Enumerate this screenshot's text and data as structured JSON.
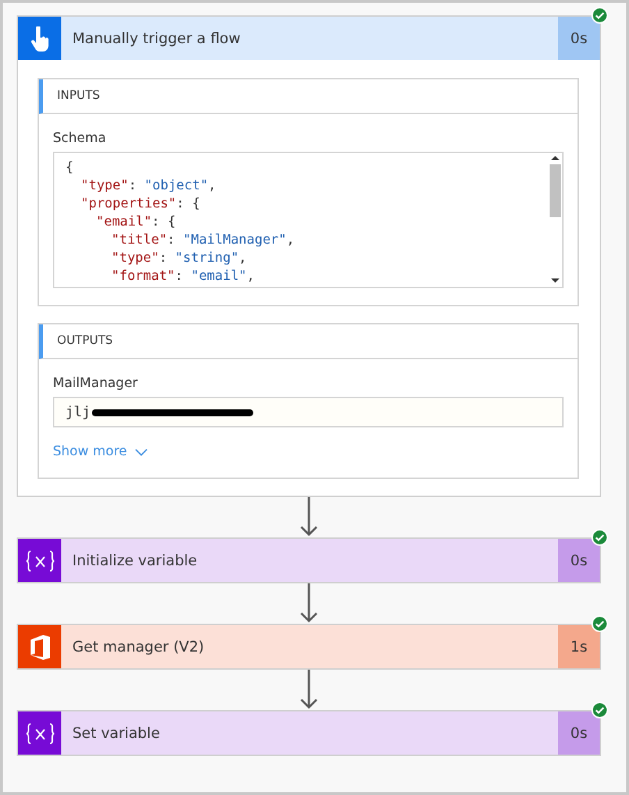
{
  "steps": [
    {
      "kind": "trigger",
      "title": "Manually trigger a flow",
      "duration": "0s",
      "succeeded": true,
      "expanded": true,
      "inputs": {
        "heading": "INPUTS",
        "field_label": "Schema",
        "code_lines": [
          {
            "tokens": [
              {
                "kind": "punct",
                "text": "{"
              }
            ],
            "children": [
              {
                "tokens": [
                  {
                    "kind": "key",
                    "text": "\"type\""
                  },
                  {
                    "kind": "punct",
                    "text": ": "
                  },
                  {
                    "kind": "string",
                    "text": "\"object\""
                  },
                  {
                    "kind": "punct",
                    "text": ","
                  }
                ]
              },
              {
                "tokens": [
                  {
                    "kind": "key",
                    "text": "\"properties\""
                  },
                  {
                    "kind": "punct",
                    "text": ": {"
                  }
                ],
                "children": [
                  {
                    "tokens": [
                      {
                        "kind": "key",
                        "text": "\"email\""
                      },
                      {
                        "kind": "punct",
                        "text": ": {"
                      }
                    ],
                    "children": [
                      {
                        "tokens": [
                          {
                            "kind": "key",
                            "text": "\"title\""
                          },
                          {
                            "kind": "punct",
                            "text": ": "
                          },
                          {
                            "kind": "string",
                            "text": "\"MailManager\""
                          },
                          {
                            "kind": "punct",
                            "text": ","
                          }
                        ]
                      },
                      {
                        "tokens": [
                          {
                            "kind": "key",
                            "text": "\"type\""
                          },
                          {
                            "kind": "punct",
                            "text": ": "
                          },
                          {
                            "kind": "string",
                            "text": "\"string\""
                          },
                          {
                            "kind": "punct",
                            "text": ","
                          }
                        ]
                      },
                      {
                        "tokens": [
                          {
                            "kind": "key",
                            "text": "\"format\""
                          },
                          {
                            "kind": "punct",
                            "text": ": "
                          },
                          {
                            "kind": "string",
                            "text": "\"email\""
                          },
                          {
                            "kind": "punct",
                            "text": ","
                          }
                        ]
                      }
                    ]
                  }
                ]
              }
            ]
          }
        ]
      },
      "outputs": {
        "heading": "OUTPUTS",
        "field_label": "MailManager",
        "value": "jlj",
        "redacted": true,
        "show_more": "Show more"
      }
    },
    {
      "kind": "variable",
      "title": "Initialize variable",
      "duration": "0s",
      "succeeded": true,
      "expanded": false
    },
    {
      "kind": "office",
      "title": "Get manager (V2)",
      "duration": "1s",
      "succeeded": true,
      "expanded": false
    },
    {
      "kind": "variable",
      "title": "Set variable",
      "duration": "0s",
      "succeeded": true,
      "expanded": false
    }
  ]
}
